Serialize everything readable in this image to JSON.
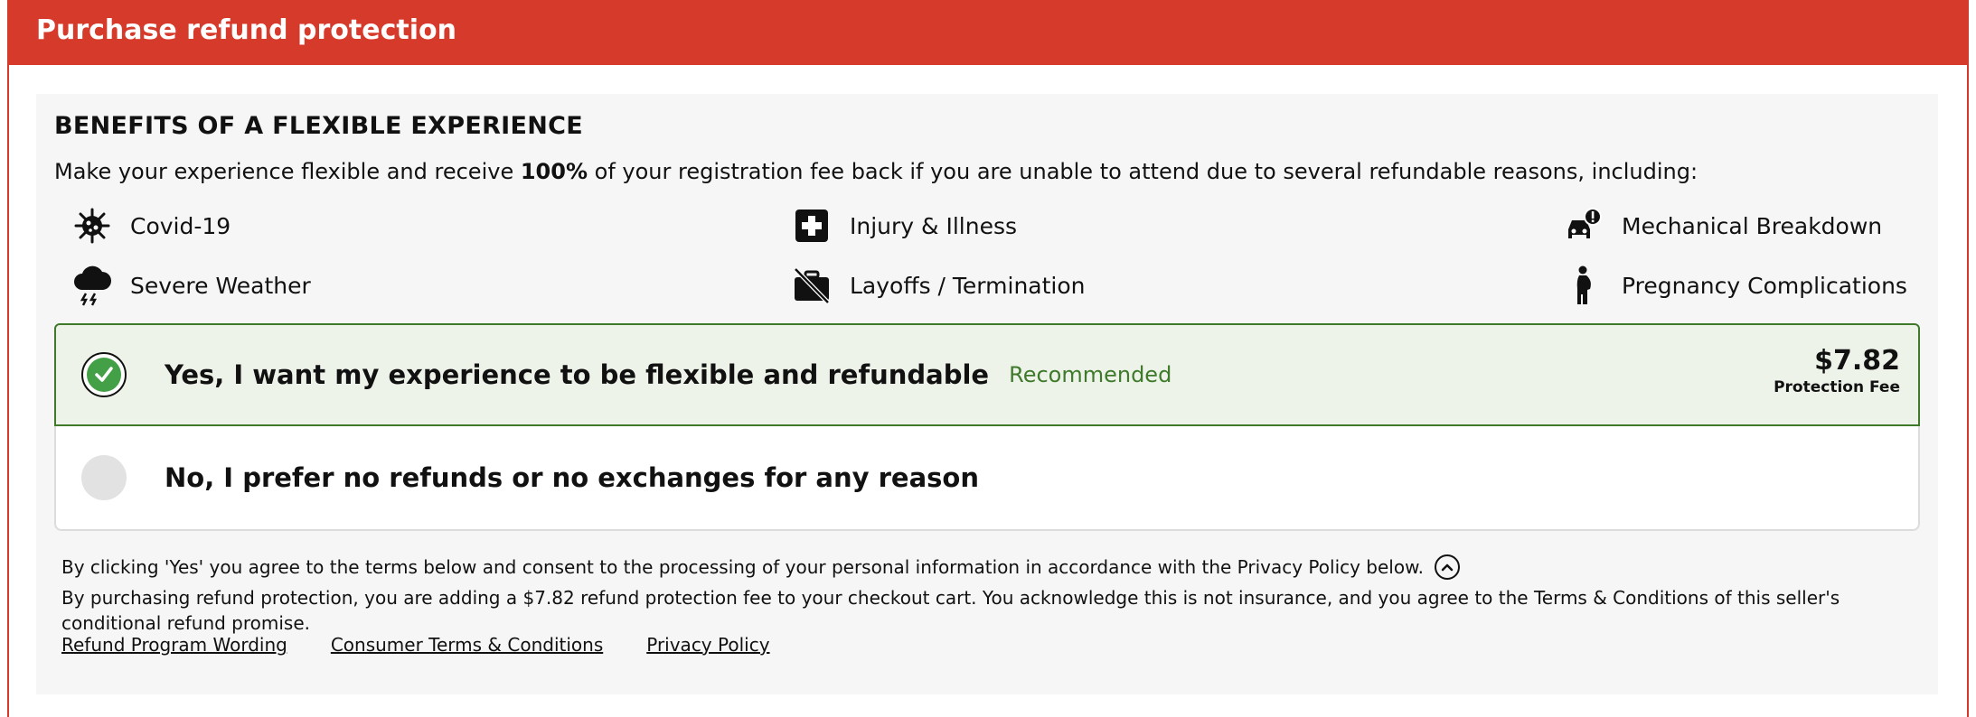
{
  "header": {
    "title": "Purchase refund protection"
  },
  "benefits": {
    "title": "BENEFITS OF A FLEXIBLE EXPERIENCE",
    "intro_before": "Make your experience flexible and receive ",
    "intro_bold": "100%",
    "intro_after": " of your registration fee back if you are unable to attend due to several refundable reasons, including:",
    "items": [
      {
        "label": "Covid-19",
        "icon": "virus-icon"
      },
      {
        "label": "Injury & Illness",
        "icon": "medical-cross-icon"
      },
      {
        "label": "Mechanical Breakdown",
        "icon": "car-alert-icon"
      },
      {
        "label": "Severe Weather",
        "icon": "storm-cloud-icon"
      },
      {
        "label": "Layoffs / Termination",
        "icon": "briefcase-off-icon"
      },
      {
        "label": "Pregnancy Complications",
        "icon": "pregnant-person-icon"
      }
    ]
  },
  "options": {
    "yes": {
      "label": "Yes, I want my experience to be flexible and refundable",
      "badge": "Recommended",
      "price": "$7.82",
      "price_label": "Protection Fee",
      "selected": true
    },
    "no": {
      "label": "No, I prefer no refunds or no exchanges for any reason",
      "selected": false
    }
  },
  "fine_print": {
    "consent": "By clicking 'Yes' you agree to the terms below and consent to the processing of your personal information in accordance with the Privacy Policy below.",
    "details": "By purchasing refund protection, you are adding a $7.82 refund protection fee to your checkout cart. You acknowledge this is not insurance, and you agree to the Terms & Conditions of this seller's conditional refund promise."
  },
  "links": {
    "refund_wording": "Refund Program Wording",
    "consumer_terms": "Consumer Terms & Conditions",
    "privacy": "Privacy Policy"
  },
  "colors": {
    "brand_red": "#d63a2a",
    "selected_green": "#3f7a2b",
    "check_green": "#43a047"
  }
}
